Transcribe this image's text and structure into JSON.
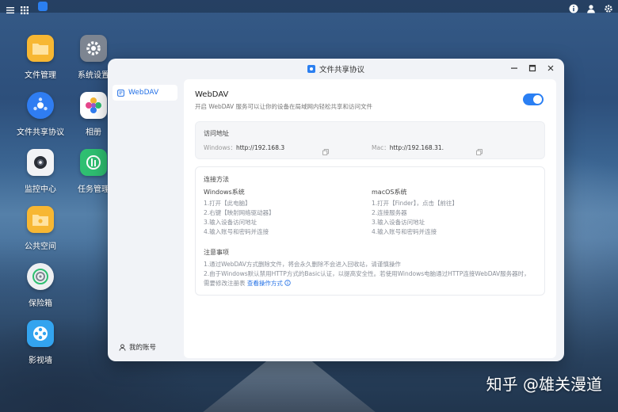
{
  "desktop": {
    "icons": [
      {
        "label": "文件管理",
        "color": "#f7b733"
      },
      {
        "label": "系统设置",
        "color": "#7d8591"
      },
      {
        "label": "文件共享协议",
        "color": "#2f7df2"
      },
      {
        "label": "相册",
        "color": "#ffffff"
      },
      {
        "label": "监控中心",
        "color": "#f2f3f5"
      },
      {
        "label": "任务管理",
        "color": "#2fbf71"
      },
      {
        "label": "公共空间",
        "color": "#f7b733"
      },
      {
        "label": "保险箱",
        "color": "#eef0f2"
      },
      {
        "label": "影视墙",
        "color": "#33a4ef"
      }
    ]
  },
  "window": {
    "title": "文件共享协议",
    "sidebar": {
      "items": [
        {
          "label": "WebDAV"
        }
      ],
      "account": "我的账号"
    },
    "webdav": {
      "title": "WebDAV",
      "description": "开启 WebDAV 服务可以让你的设备在局域网内轻松共享和访问文件",
      "enabled": true
    },
    "address": {
      "heading": "访问地址",
      "windows_label": "Windows：",
      "windows_value": "http://192.168.3",
      "mac_label": "Mac：",
      "mac_value": "http://192.168.31."
    },
    "method": {
      "heading": "连接方法",
      "windows": {
        "title": "Windows系统",
        "steps": [
          "1.打开【此电脑】",
          "2.右键【映射网络驱动器】",
          "3.输入设备访问地址",
          "4.输入账号和密码并连接"
        ]
      },
      "mac": {
        "title": "macOS系统",
        "steps": [
          "1.打开【Finder】，点击【前往】",
          "2.连接服务器",
          "3.输入设备访问地址",
          "4.输入账号和密码并连接"
        ]
      },
      "notes_heading": "注意事项",
      "note1": "1.通过WebDAV方式删除文件，将会永久删除不会进入回收站，请谨慎操作",
      "note2": "2.由于Windows默认禁用HTTP方式的Basic认证，以提高安全性。若使用Windows电脑通过HTTP连接WebDAV服务器时，",
      "note3": "需要修改注册表",
      "note3_link": "查看操作方式"
    }
  },
  "watermark": "知乎 @雄关漫道",
  "accent_color": "#2a7ff3"
}
